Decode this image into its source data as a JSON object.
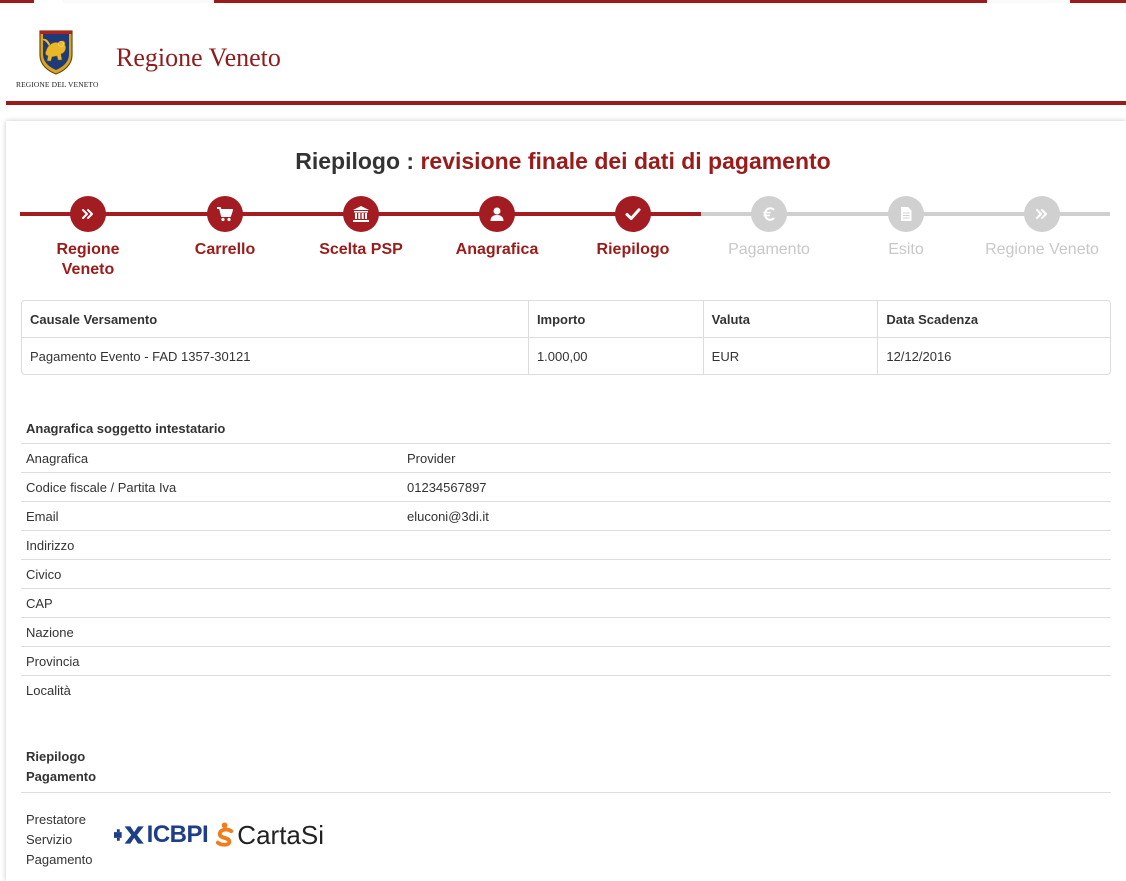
{
  "header": {
    "site_title": "Regione Veneto",
    "logo_caption": "REGIONE DEL VENETO"
  },
  "page_title": {
    "prefix": "Riepilogo : ",
    "accent": "revisione finale dei dati di pagamento"
  },
  "steps": [
    {
      "label": "Regione Veneto",
      "icon": "double-chevron-right-icon",
      "state": "done"
    },
    {
      "label": "Carrello",
      "icon": "cart-icon",
      "state": "done"
    },
    {
      "label": "Scelta PSP",
      "icon": "bank-icon",
      "state": "done"
    },
    {
      "label": "Anagrafica",
      "icon": "user-icon",
      "state": "done"
    },
    {
      "label": "Riepilogo",
      "icon": "check-icon",
      "state": "done"
    },
    {
      "label": "Pagamento",
      "icon": "euro-icon",
      "state": "todo"
    },
    {
      "label": "Esito",
      "icon": "document-icon",
      "state": "todo"
    },
    {
      "label": "Regione Veneto",
      "icon": "double-chevron-right-icon",
      "state": "todo"
    }
  ],
  "payment_table": {
    "headers": [
      "Causale Versamento",
      "Importo",
      "Valuta",
      "Data Scadenza"
    ],
    "rows": [
      [
        "Pagamento Evento - FAD 1357-30121",
        "1.000,00",
        "EUR",
        "12/12/2016"
      ]
    ]
  },
  "anagrafica": {
    "title": "Anagrafica soggetto intestatario",
    "rows": [
      {
        "key": "Anagrafica",
        "value": "Provider"
      },
      {
        "key": "Codice fiscale / Partita Iva",
        "value": "01234567897"
      },
      {
        "key": "Email",
        "value": "eluconi@3di.it"
      },
      {
        "key": "Indirizzo",
        "value": ""
      },
      {
        "key": "Civico",
        "value": ""
      },
      {
        "key": "CAP",
        "value": ""
      },
      {
        "key": "Nazione",
        "value": ""
      },
      {
        "key": "Provincia",
        "value": ""
      },
      {
        "key": "Località",
        "value": ""
      }
    ]
  },
  "riepilogo_pagamento": {
    "title_line1": "Riepilogo",
    "title_line2": "Pagamento",
    "psp_label_line1": "Prestatore",
    "psp_label_line2": "Servizio",
    "psp_label_line3": "Pagamento",
    "psp_logo_text_1": "ICBPI",
    "psp_logo_text_2": "CartaSi"
  },
  "colors": {
    "brand": "#9b1b1b",
    "step_done": "#a31c22",
    "step_todo": "#d0d0d0",
    "icbpi_blue": "#1e3f86",
    "cartasi_orange": "#f07c1c"
  }
}
